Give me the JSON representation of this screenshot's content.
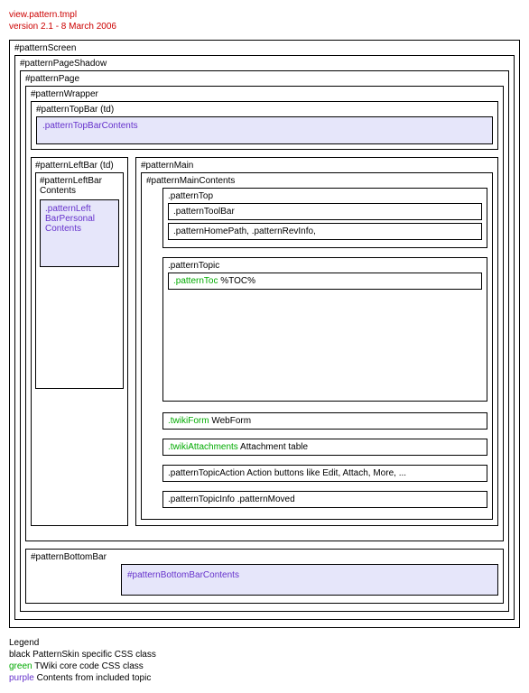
{
  "header": {
    "file": "view.pattern.tmpl",
    "version": "version 2.1 - 8 March 2006"
  },
  "patternScreen": {
    "label": "#patternScreen"
  },
  "patternPageShadow": {
    "label": "#patternPageShadow"
  },
  "patternPage": {
    "label": "#patternPage"
  },
  "patternWrapper": {
    "label": "#patternWrapper"
  },
  "patternTopBar": {
    "label": "#patternTopBar (td)",
    "contents": {
      "label": ".patternTopBarContents"
    }
  },
  "patternLeftBar": {
    "label": "#patternLeftBar (td)",
    "contents": {
      "label_line1": "#patternLeftBar",
      "label_line2": "Contents",
      "personal": {
        "line1": ".patternLeft",
        "line2": "BarPersonal",
        "line3": "Contents"
      }
    }
  },
  "patternMain": {
    "label": "#patternMain",
    "contents": {
      "label": "#patternMainContents"
    },
    "top": {
      "label": ".patternTop",
      "toolbar": ".patternToolBar",
      "homePath": ".patternHomePath, .patternRevInfo,"
    },
    "topic": {
      "label": ".patternTopic",
      "toc_class": ".patternToc",
      "toc_text": " %TOC%"
    },
    "form": {
      "class": ".twikiForm",
      "text": " WebForm"
    },
    "attachments": {
      "class": ".twikiAttachments",
      "text": " Attachment table"
    },
    "topicAction": ".patternTopicAction Action buttons like Edit, Attach, More, ...",
    "topicInfo": ".patternTopicInfo .patternMoved"
  },
  "patternBottomBar": {
    "label": "#patternBottomBar",
    "contents": {
      "label": "#patternBottomBarContents"
    }
  },
  "legend": {
    "title": "Legend",
    "black_label": "black",
    "black_text": " PatternSkin specific CSS class",
    "green_label": "green",
    "green_text": " TWiki core code CSS class",
    "purple_label": "purple",
    "purple_text": " Contents from included topic"
  }
}
